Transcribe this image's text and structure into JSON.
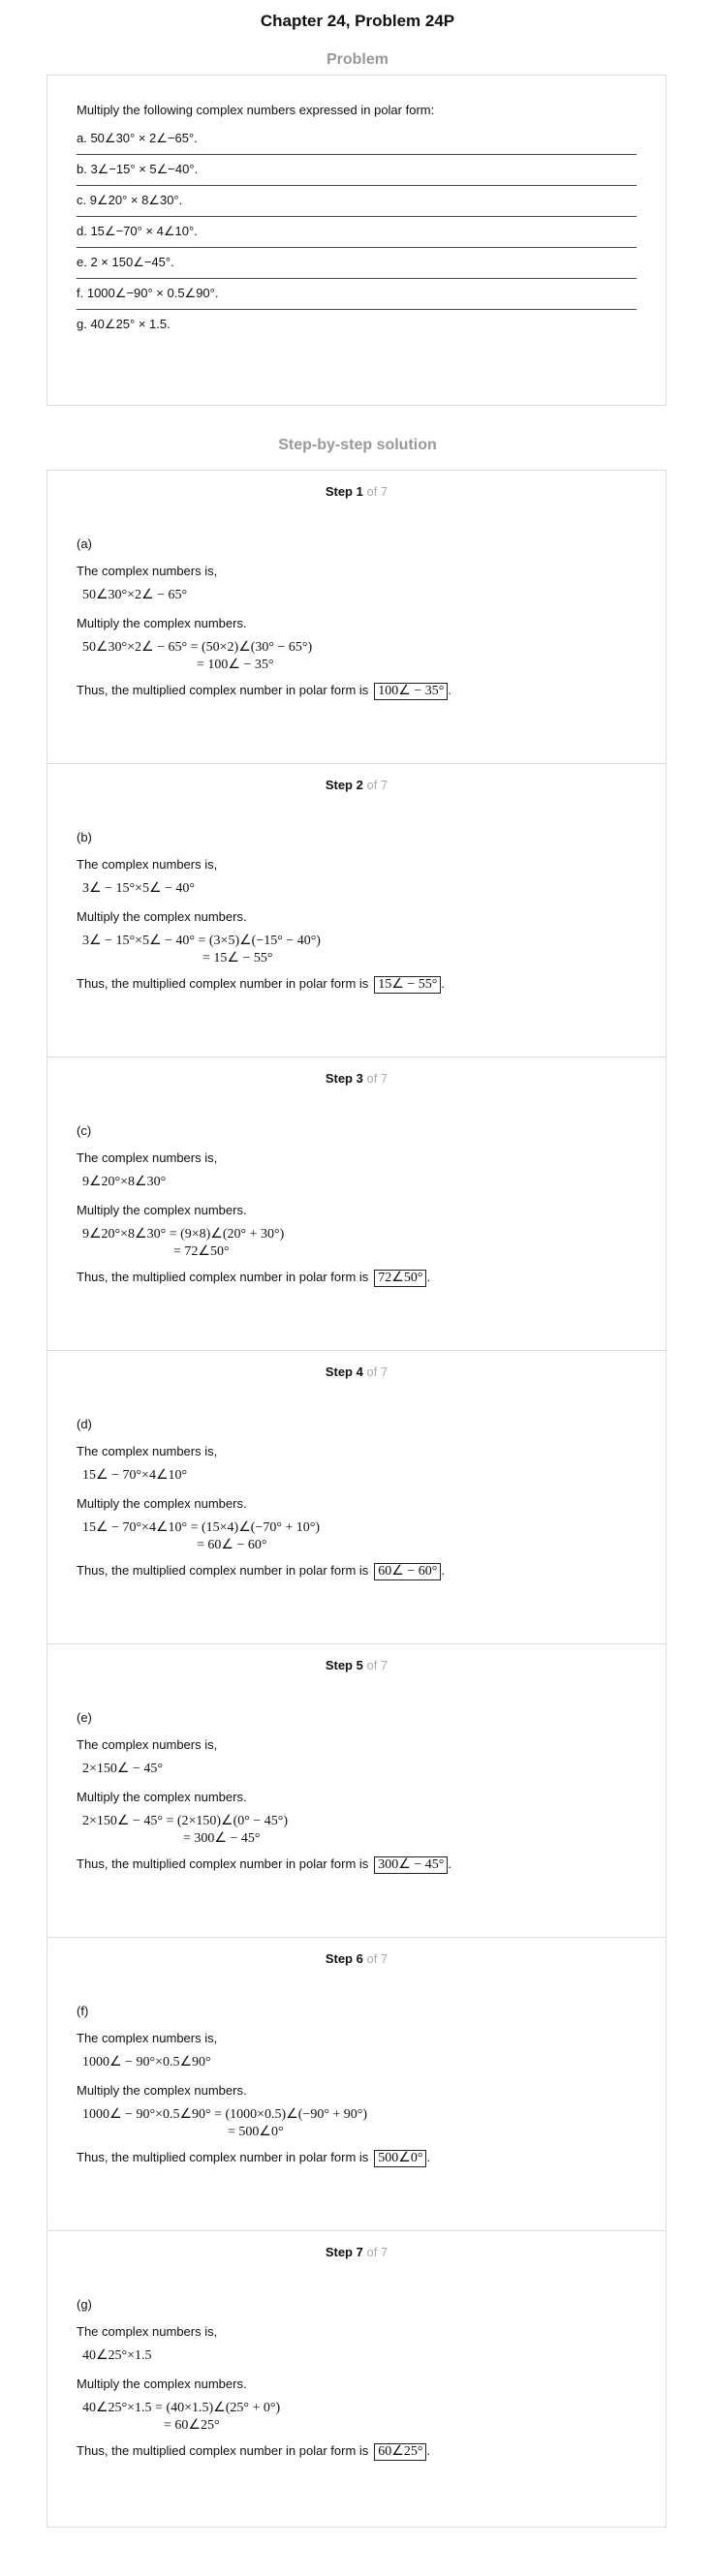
{
  "page_title": "Chapter 24, Problem 24P",
  "problem_heading": "Problem",
  "problem": {
    "intro": "Multiply the following complex numbers expressed in polar form:",
    "items": [
      "a. 50∠30° × 2∠−65°.",
      "b. 3∠−15° × 5∠−40°.",
      "c. 9∠20° × 8∠30°.",
      "d. 15∠−70° × 4∠10°.",
      "e. 2 × 150∠−45°.",
      "f. 1000∠−90° × 0.5∠90°.",
      "g. 40∠25° × 1.5."
    ]
  },
  "solution_heading": "Step-by-step solution",
  "steps": [
    {
      "label": "Step 1",
      "of": "of 7",
      "part": "(a)",
      "text1": "The complex numbers is,",
      "expr": "50∠30°×2∠ − 65°",
      "text2": "Multiply the complex numbers.",
      "eq1": "50∠30°×2∠ − 65° = (50×2)∠(30° − 65°)",
      "eq2": "= 100∠ − 35°",
      "result_text": "Thus, the multiplied complex number in polar form is",
      "answer": "100∠ − 35°"
    },
    {
      "label": "Step 2",
      "of": "of 7",
      "part": "(b)",
      "text1": "The complex numbers is,",
      "expr": "3∠ − 15°×5∠ − 40°",
      "text2": "Multiply the complex numbers.",
      "eq1": "3∠ − 15°×5∠ − 40° = (3×5)∠(−15° − 40°)",
      "eq2": "= 15∠ − 55°",
      "result_text": "Thus, the multiplied complex number in polar form is",
      "answer": "15∠ − 55°"
    },
    {
      "label": "Step 3",
      "of": "of 7",
      "part": "(c)",
      "text1": "The complex numbers is,",
      "expr": "9∠20°×8∠30°",
      "text2": "Multiply the complex numbers.",
      "eq1": "9∠20°×8∠30° = (9×8)∠(20° + 30°)",
      "eq2": "= 72∠50°",
      "result_text": "Thus, the multiplied complex number in polar form is",
      "answer": "72∠50°"
    },
    {
      "label": "Step 4",
      "of": "of 7",
      "part": "(d)",
      "text1": "The complex numbers is,",
      "expr": "15∠ − 70°×4∠10°",
      "text2": "Multiply the complex numbers.",
      "eq1": "15∠ − 70°×4∠10° = (15×4)∠(−70° + 10°)",
      "eq2": "= 60∠ − 60°",
      "result_text": "Thus, the multiplied complex number in polar form is",
      "answer": "60∠ − 60°"
    },
    {
      "label": "Step 5",
      "of": "of 7",
      "part": "(e)",
      "text1": "The complex numbers is,",
      "expr": "2×150∠ − 45°",
      "text2": "Multiply the complex numbers.",
      "eq1": "2×150∠ − 45° = (2×150)∠(0° − 45°)",
      "eq2": "= 300∠ − 45°",
      "result_text": "Thus, the multiplied complex number in polar form is",
      "answer": "300∠ − 45°"
    },
    {
      "label": "Step 6",
      "of": "of 7",
      "part": "(f)",
      "text1": "The complex numbers is,",
      "expr": "1000∠ − 90°×0.5∠90°",
      "text2": "Multiply the complex numbers.",
      "eq1": "1000∠ − 90°×0.5∠90° = (1000×0.5)∠(−90° + 90°)",
      "eq2": "= 500∠0°",
      "result_text": "Thus, the multiplied complex number in polar form is",
      "answer": "500∠0°"
    },
    {
      "label": "Step 7",
      "of": "of 7",
      "part": "(g)",
      "text1": "The complex numbers is,",
      "expr": "40∠25°×1.5",
      "text2": "Multiply the complex numbers.",
      "eq1": "40∠25°×1.5 = (40×1.5)∠(25° + 0°)",
      "eq2": "= 60∠25°",
      "result_text": "Thus, the multiplied complex number in polar form is",
      "answer": "60∠25°"
    }
  ]
}
